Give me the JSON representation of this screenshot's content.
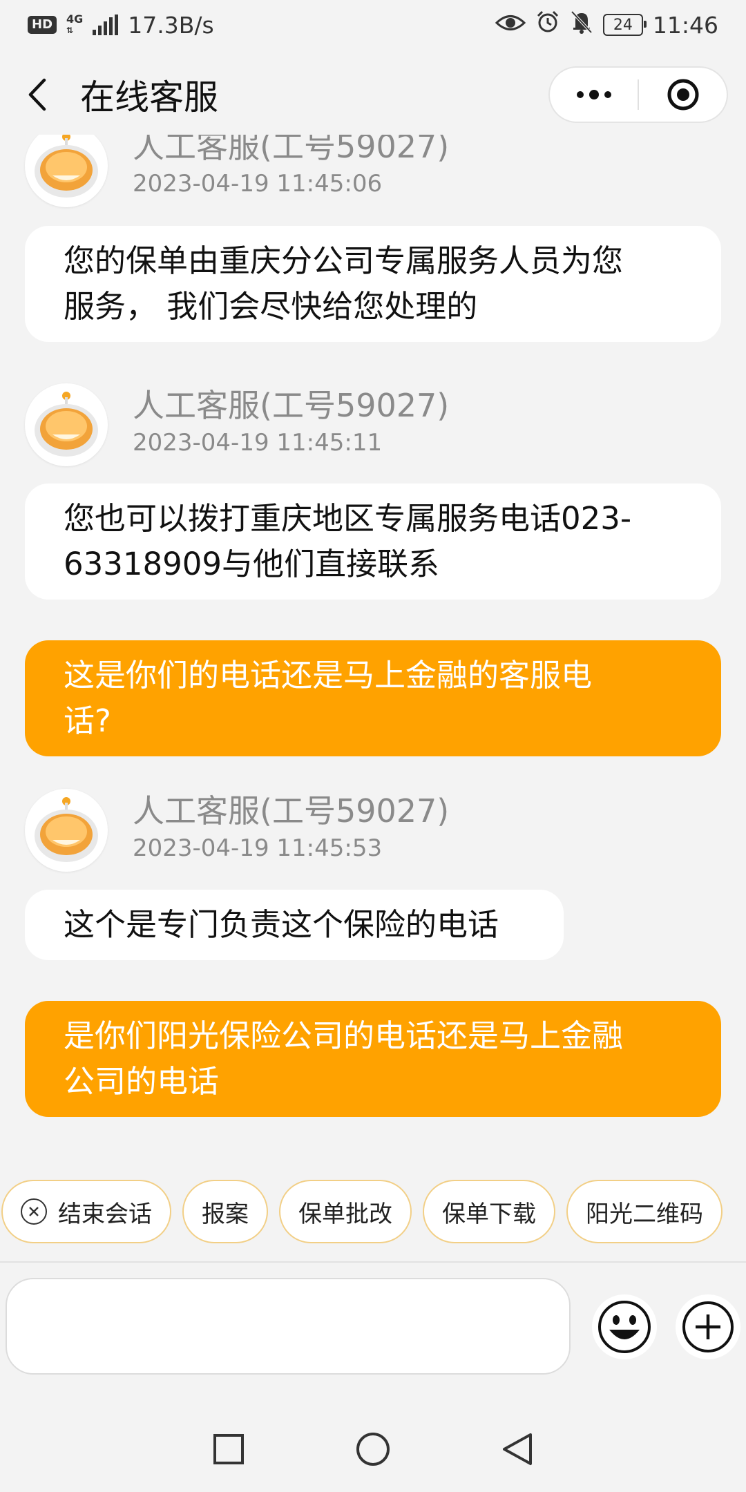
{
  "status_bar": {
    "hd": "HD",
    "network": "4G",
    "speed": "17.3B/s",
    "battery": "24",
    "time": "11:46"
  },
  "header": {
    "title": "在线客服",
    "back_icon": "back-chevron-icon",
    "more_icon": "more-dots-icon",
    "close_icon": "target-circle-icon"
  },
  "messages": [
    {
      "role": "agent",
      "name": "人工客服(工号59027)",
      "time": "2023-04-19 11:45:06",
      "lines": [
        "您的保单由重庆分公司专属服务人员为您",
        "服务， 我们会尽快给您处理的"
      ]
    },
    {
      "role": "agent",
      "name": "人工客服(工号59027)",
      "time": "2023-04-19 11:45:11",
      "lines": [
        "您也可以拨打重庆地区专属服务电话023-",
        "63318909与他们直接联系"
      ]
    },
    {
      "role": "user",
      "lines": [
        "这是你们的电话还是马上金融的客服电",
        "话?"
      ]
    },
    {
      "role": "agent",
      "name": "人工客服(工号59027)",
      "time": "2023-04-19 11:45:53",
      "lines": [
        "这个是专门负责这个保险的电话"
      ]
    },
    {
      "role": "user",
      "lines": [
        "是你们阳光保险公司的电话还是马上金融",
        "公司的电话"
      ]
    }
  ],
  "quick_actions": [
    "结束会话",
    "报案",
    "保单批改",
    "保单下载",
    "阳光二维码"
  ],
  "input": {
    "placeholder": "",
    "value": ""
  },
  "colors": {
    "accent": "#ffa200",
    "chip_border": "#f2cf86",
    "background": "#f3f3f3"
  }
}
